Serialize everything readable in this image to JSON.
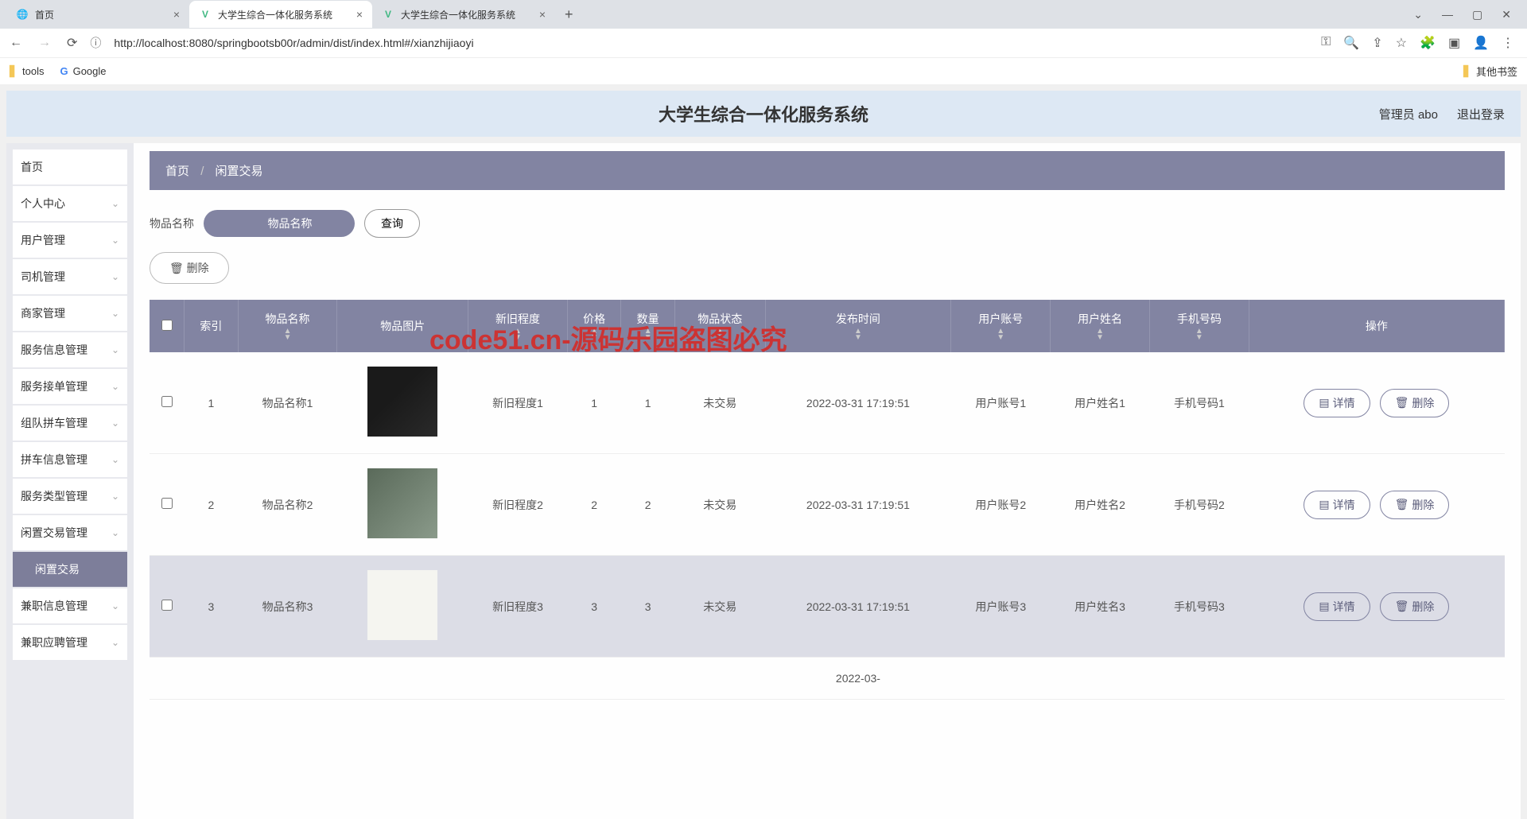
{
  "browser": {
    "tabs": [
      {
        "title": "首页",
        "icon": "🌐"
      },
      {
        "title": "大学生综合一体化服务系统",
        "icon": "V"
      },
      {
        "title": "大学生综合一体化服务系统",
        "icon": "V"
      }
    ],
    "url": "http://localhost:8080/springbootsb00r/admin/dist/index.html#/xianzhijiaoyi",
    "bookmarks": {
      "tools": "tools",
      "google": "Google",
      "other": "其他书签"
    }
  },
  "header": {
    "title": "大学生综合一体化服务系统",
    "admin": "管理员 abo",
    "logout": "退出登录"
  },
  "sidebar": {
    "items": [
      {
        "label": "首页",
        "expandable": false
      },
      {
        "label": "个人中心",
        "expandable": true
      },
      {
        "label": "用户管理",
        "expandable": true
      },
      {
        "label": "司机管理",
        "expandable": true
      },
      {
        "label": "商家管理",
        "expandable": true
      },
      {
        "label": "服务信息管理",
        "expandable": true
      },
      {
        "label": "服务接单管理",
        "expandable": true
      },
      {
        "label": "组队拼车管理",
        "expandable": true
      },
      {
        "label": "拼车信息管理",
        "expandable": true
      },
      {
        "label": "服务类型管理",
        "expandable": true
      },
      {
        "label": "闲置交易管理",
        "expandable": true
      },
      {
        "label": "闲置交易",
        "expandable": false,
        "sub": true
      },
      {
        "label": "兼职信息管理",
        "expandable": true
      },
      {
        "label": "兼职应聘管理",
        "expandable": true
      }
    ]
  },
  "breadcrumb": {
    "home": "首页",
    "current": "闲置交易"
  },
  "search": {
    "label": "物品名称",
    "placeholder": "物品名称",
    "query_btn": "查询"
  },
  "toolbar": {
    "delete_btn": "删除"
  },
  "table": {
    "headers": [
      "",
      "索引",
      "物品名称",
      "物品图片",
      "新旧程度",
      "价格",
      "数量",
      "物品状态",
      "发布时间",
      "用户账号",
      "用户姓名",
      "手机号码",
      "操作"
    ],
    "rows": [
      {
        "index": "1",
        "name": "物品名称1",
        "condition": "新旧程度1",
        "price": "1",
        "qty": "1",
        "status": "未交易",
        "time": "2022-03-31 17:19:51",
        "account": "用户账号1",
        "username": "用户姓名1",
        "phone": "手机号码1"
      },
      {
        "index": "2",
        "name": "物品名称2",
        "condition": "新旧程度2",
        "price": "2",
        "qty": "2",
        "status": "未交易",
        "time": "2022-03-31 17:19:51",
        "account": "用户账号2",
        "username": "用户姓名2",
        "phone": "手机号码2"
      },
      {
        "index": "3",
        "name": "物品名称3",
        "condition": "新旧程度3",
        "price": "3",
        "qty": "3",
        "status": "未交易",
        "time": "2022-03-31 17:19:51",
        "account": "用户账号3",
        "username": "用户姓名3",
        "phone": "手机号码3"
      }
    ],
    "partial_time": "2022-03-",
    "detail_btn": "详情",
    "delete_btn": "删除"
  },
  "watermark": "code51.cn-源码乐园盗图必究"
}
